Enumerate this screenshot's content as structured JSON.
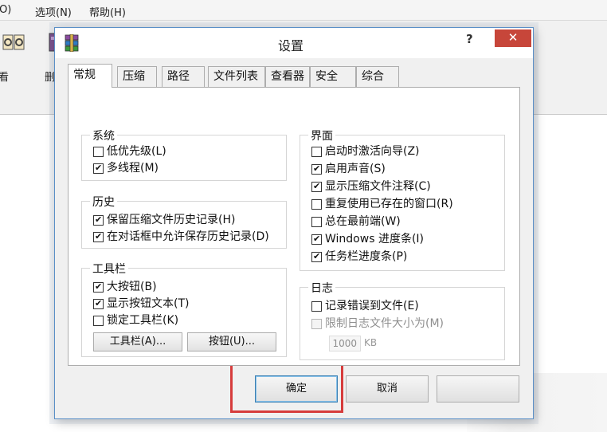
{
  "menubar": {
    "items": [
      "(O)",
      "选项(N)",
      "帮助(H)"
    ]
  },
  "toolbar": {
    "items": [
      "看",
      "删"
    ]
  },
  "dialog": {
    "title": "设置",
    "help_glyph": "?",
    "close_glyph": "✕",
    "tabs": [
      "常规",
      "压缩",
      "路径",
      "文件列表",
      "查看器",
      "安全",
      "综合"
    ],
    "active_tab": "常规",
    "groups": {
      "system": {
        "title": "系统",
        "items": [
          {
            "label": "低优先级(L)",
            "checked": false
          },
          {
            "label": "多线程(M)",
            "checked": true
          }
        ]
      },
      "history": {
        "title": "历史",
        "items": [
          {
            "label": "保留压缩文件历史记录(H)",
            "checked": true
          },
          {
            "label": "在对话框中允许保存历史记录(D)",
            "checked": true
          }
        ]
      },
      "toolbar": {
        "title": "工具栏",
        "items": [
          {
            "label": "大按钮(B)",
            "checked": true
          },
          {
            "label": "显示按钮文本(T)",
            "checked": true
          },
          {
            "label": "锁定工具栏(K)",
            "checked": false
          }
        ],
        "toolbar_button": "工具栏(A)...",
        "buttons_button": "按钮(U)..."
      },
      "interface": {
        "title": "界面",
        "items": [
          {
            "label": "启动时激活向导(Z)",
            "checked": false
          },
          {
            "label": "启用声音(S)",
            "checked": true
          },
          {
            "label": "显示压缩文件注释(C)",
            "checked": true
          },
          {
            "label": "重复使用已存在的窗口(R)",
            "checked": false
          },
          {
            "label": "总在最前端(W)",
            "checked": false
          },
          {
            "label": "Windows 进度条(I)",
            "checked": true
          },
          {
            "label": "任务栏进度条(P)",
            "checked": true
          }
        ]
      },
      "log": {
        "title": "日志",
        "items": [
          {
            "label": "记录错误到文件(E)",
            "checked": false
          },
          {
            "label": "限制日志文件大小为(M)",
            "checked": false,
            "disabled": true
          }
        ],
        "size_value": "1000",
        "size_unit": "KB"
      }
    },
    "ok": "确定",
    "cancel": "取消"
  },
  "annotation": {
    "color": "#d63c3c"
  }
}
